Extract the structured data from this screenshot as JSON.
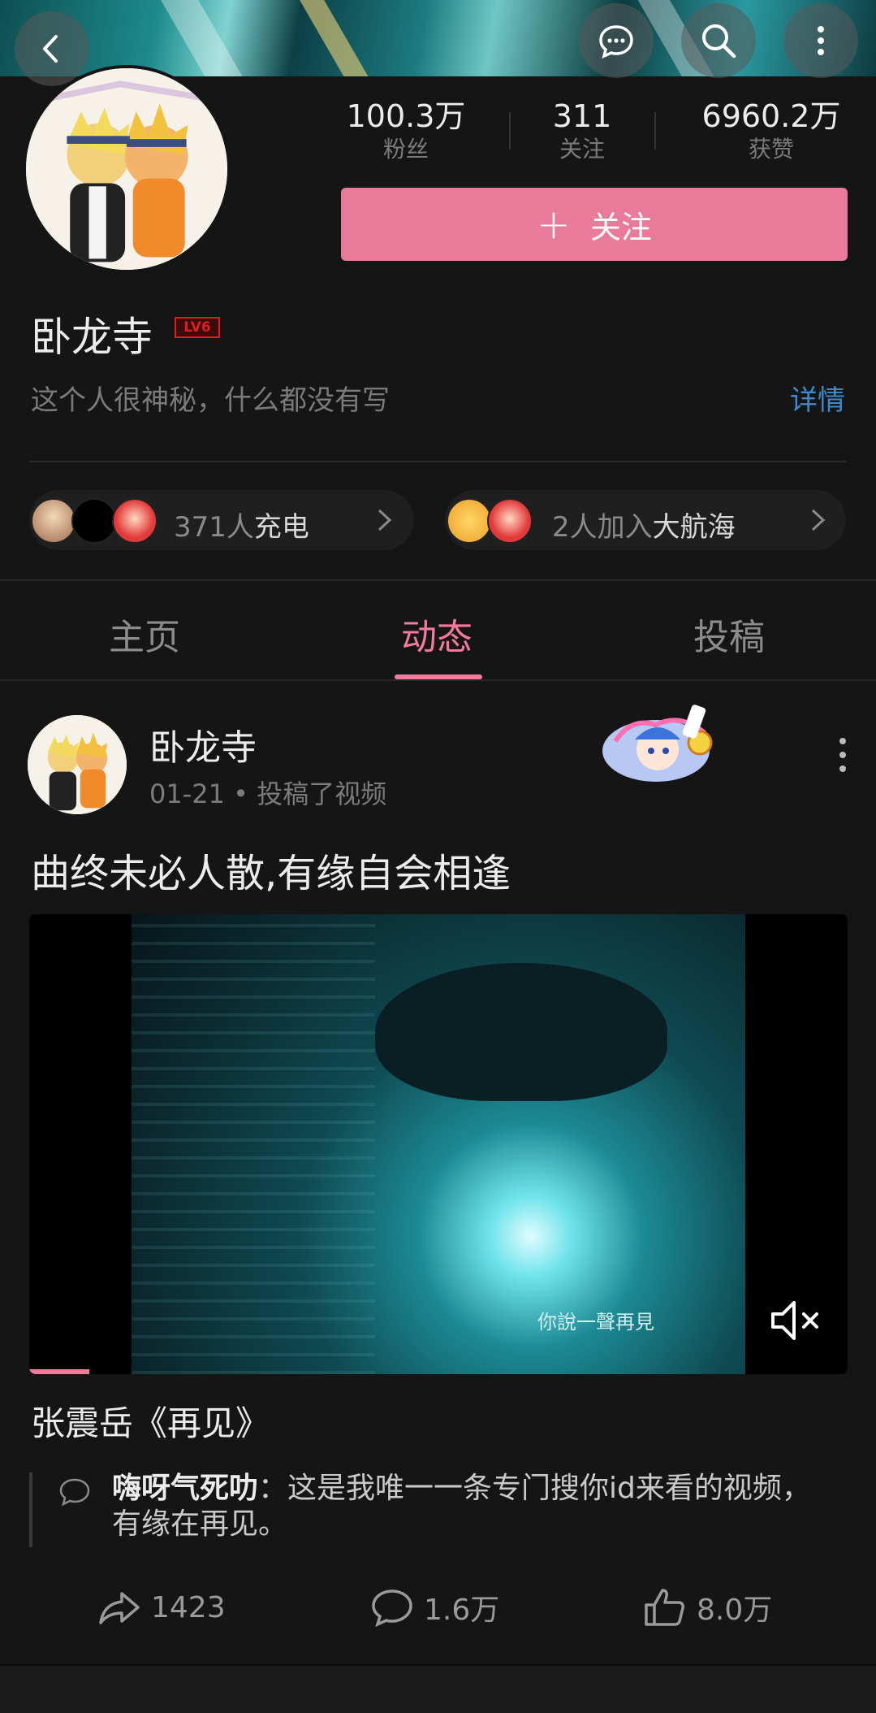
{
  "header": {
    "back_icon": "back-arrow-icon",
    "message_icon": "message-icon",
    "search_icon": "search-icon",
    "more_icon": "more-vertical-icon"
  },
  "profile": {
    "stats": [
      {
        "value": "100.3万",
        "label": "粉丝"
      },
      {
        "value": "311",
        "label": "关注"
      },
      {
        "value": "6960.2万",
        "label": "获赞"
      }
    ],
    "follow_label": "关注",
    "username": "卧龙寺",
    "level_badge": "LV6",
    "bio": "这个人很神秘，什么都没有写",
    "detail_link": "详情",
    "charge": {
      "count_text": "371人",
      "action": "充电"
    },
    "voyage": {
      "count_text": "2人加入",
      "action": "大航海"
    }
  },
  "tabs": [
    {
      "label": "主页",
      "active": false
    },
    {
      "label": "动态",
      "active": true
    },
    {
      "label": "投稿",
      "active": false
    }
  ],
  "post": {
    "author": "卧龙寺",
    "meta": "01-21 • 投稿了视频",
    "text": "曲终未必人散,有缘自会相逢",
    "video_subtitle": "你說一聲再見",
    "video_title": "张震岳《再见》",
    "comment_user": "嗨呀气死叻",
    "comment_text": "：这是我唯一一条专门搜你id来看的视频，有缘在再见。",
    "actions": {
      "share": "1423",
      "comment": "1.6万",
      "like": "8.0万"
    }
  },
  "colors": {
    "accent": "#f07b9c",
    "follow_button": "#ea7a99",
    "link": "#3a8bd0",
    "background": "#151515"
  }
}
